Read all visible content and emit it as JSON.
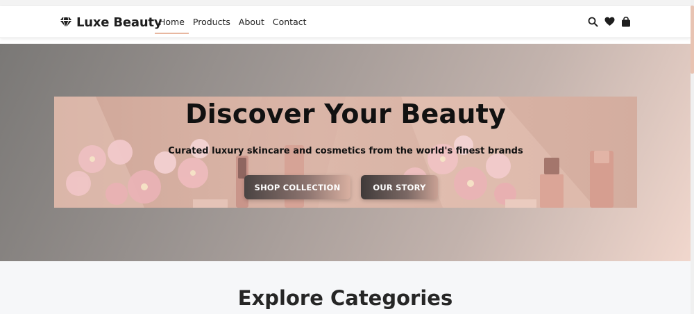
{
  "brand": {
    "name": "Luxe Beauty",
    "icon": "diamond-icon"
  },
  "nav": {
    "links": [
      {
        "label": "Home",
        "active": true
      },
      {
        "label": "Products",
        "active": false
      },
      {
        "label": "About",
        "active": false
      },
      {
        "label": "Contact",
        "active": false
      }
    ],
    "icons": [
      "search-icon",
      "heart-icon",
      "shopping-bag-icon"
    ]
  },
  "hero": {
    "title": "Discover Your Beauty",
    "subtitle": "Curated luxury skincare and cosmetics from the world's finest brands",
    "buttons": {
      "primary": "SHOP COLLECTION",
      "secondary": "OUR STORY"
    }
  },
  "categories": {
    "title": "Explore Categories"
  },
  "colors": {
    "accent": "#e8b7a0",
    "text_dark": "#1e1e1e",
    "section_bg": "#f6f7f9"
  }
}
